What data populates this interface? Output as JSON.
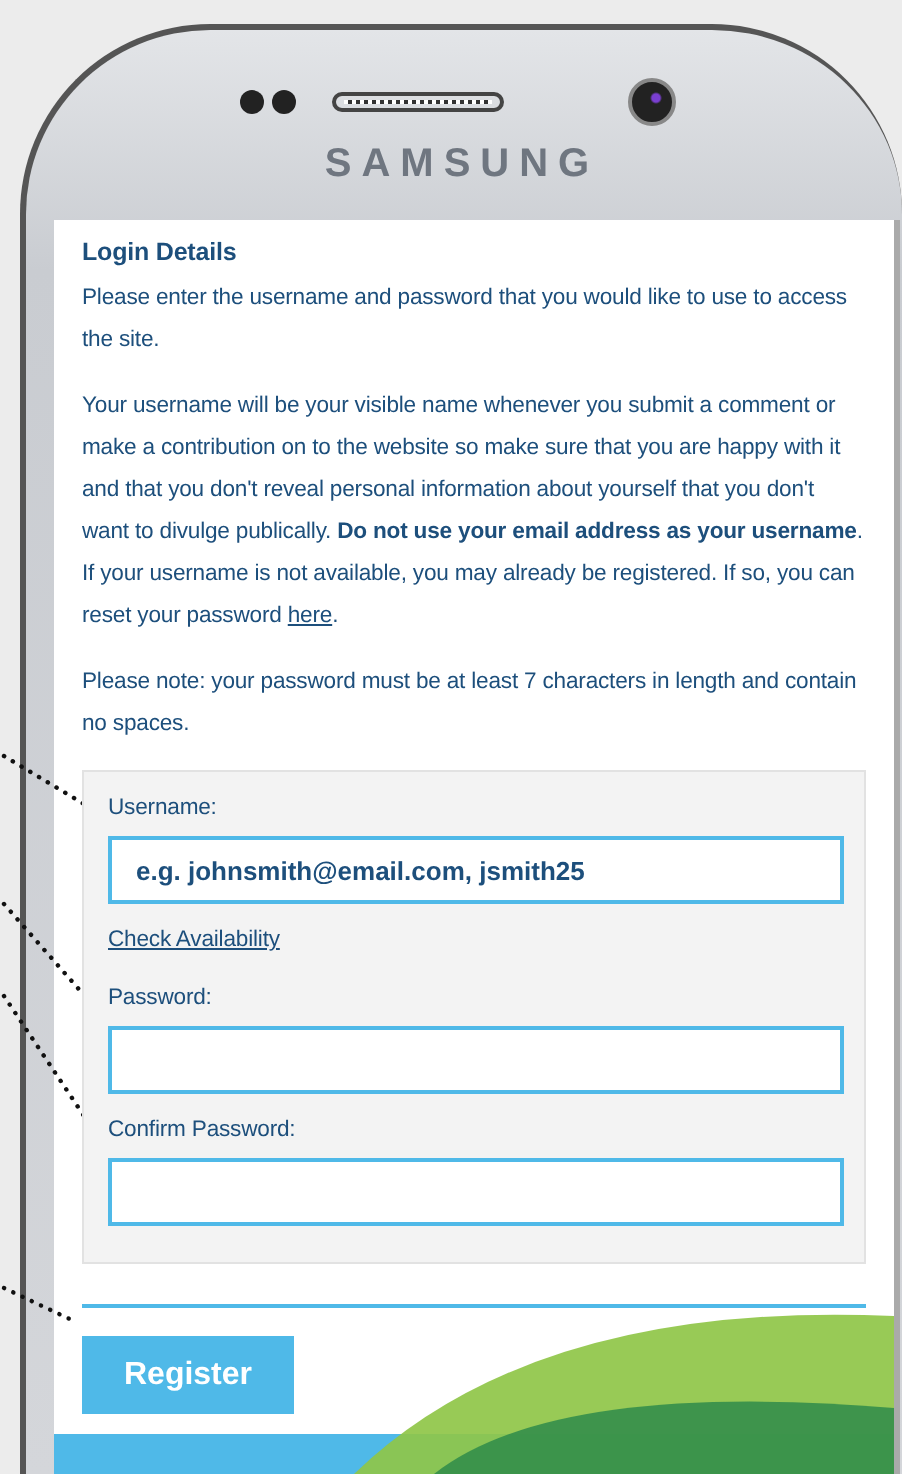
{
  "device": {
    "brand": "SAMSUNG"
  },
  "login": {
    "heading": "Login Details",
    "paragraphs": [
      {
        "text": "Please enter the username and password that you would like to use to access the site."
      },
      {
        "text": "Your username will be your visible name whenever you submit a comment or make a contribution on to the website so make sure that you are happy with it and that you don't reveal personal information about yourself that you don't want to divulge publically. **Do not use your email address as your username**. If your username is not available, you may already be registered. If so, you can reset your password",
        "link": "here",
        "after": "."
      },
      {
        "text": "Please note: your password must be at least 7 characters in length and contain no spaces."
      }
    ],
    "fields": [
      {
        "label": "Username:",
        "placeholder": "e.g. johnsmith@email.com, jsmith25",
        "link": "Check Availability"
      },
      {
        "label": "Password:"
      },
      {
        "label": "Confirm Password:"
      }
    ],
    "submit": "Register"
  }
}
